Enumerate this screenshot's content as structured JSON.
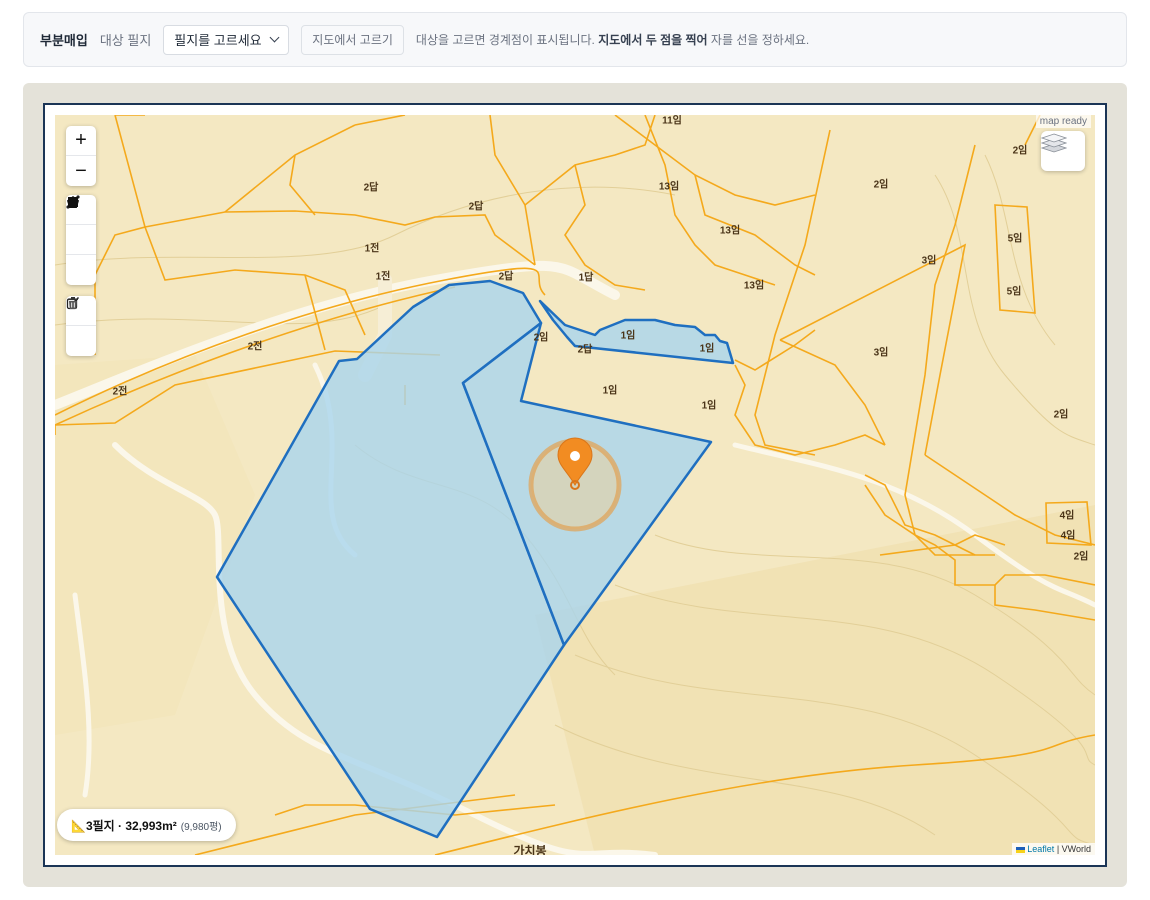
{
  "toolbar": {
    "title": "부분매입",
    "target_label": "대상 필지",
    "select_value": "필지를 고르세요",
    "pick_on_map_button": "지도에서 고르기",
    "hint_pre": "대상을 고르면 경계점이 표시됩니다.",
    "hint_bold": "지도에서 두 점을 찍어",
    "hint_post": "자를 선을 정하세요."
  },
  "map": {
    "status": "map ready",
    "zoom_in": "+",
    "zoom_out": "−",
    "area_summary": "📐3필지 · 32,993m²",
    "area_pyeong": "(9,980평)",
    "attribution_leaflet": "Leaflet",
    "attribution_sep": " | ",
    "attribution_source": "VWorld",
    "road_name": "가치봉",
    "parcel_labels": [
      "11임",
      "2임",
      "2답",
      "2답",
      "13임",
      "13임",
      "2임",
      "1전",
      "1전",
      "1답",
      "2답",
      "13임",
      "3임",
      "5임",
      "5임",
      "2전",
      "2전",
      "2임",
      "2답",
      "1임",
      "1임",
      "3임",
      "1임",
      "1임",
      "2임",
      "4임",
      "4임",
      "2임"
    ],
    "icons": {
      "zoom_in": "plus-icon",
      "zoom_out": "minus-icon",
      "line": "draw-line-icon",
      "polygon": "draw-polygon-icon",
      "rectangle": "draw-rectangle-icon",
      "edit": "edit-icon",
      "delete": "trash-icon",
      "layers": "layers-icon",
      "marker": "map-pin-icon"
    },
    "colors": {
      "selection_fill": "#a9d5ee",
      "selection_stroke": "#1f6fc0",
      "parcel_line": "#f4a91c",
      "marker": "#f28c22",
      "map_bg": "#f4e8c2"
    }
  }
}
